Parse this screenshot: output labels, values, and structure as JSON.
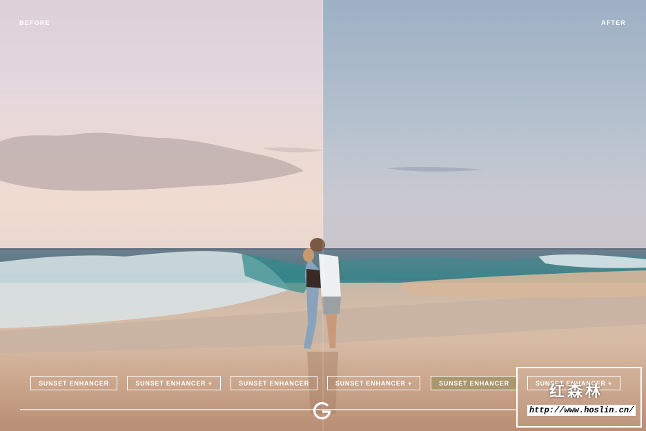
{
  "labels": {
    "before": "BEFORE",
    "after": "AFTER"
  },
  "presets": [
    {
      "label": "SUNSET ENHANCER",
      "active": false
    },
    {
      "label": "SUNSET ENHANCER +",
      "active": false
    },
    {
      "label": "SUNSET ENHANCER",
      "active": false
    },
    {
      "label": "SUNSET ENHANCER +",
      "active": false
    },
    {
      "label": "SUNSET ENHANCER",
      "active": true
    },
    {
      "label": "SUNSET ENHANCER +",
      "active": false
    }
  ],
  "logo": {
    "icon": "g-logo-icon"
  },
  "watermark": {
    "text": "红森林",
    "url": "http://www.hoslin.cn/"
  },
  "colors": {
    "active_preset": "#a0916a",
    "before_sky": "#e4d7dd",
    "after_sky": "#aebccb"
  }
}
